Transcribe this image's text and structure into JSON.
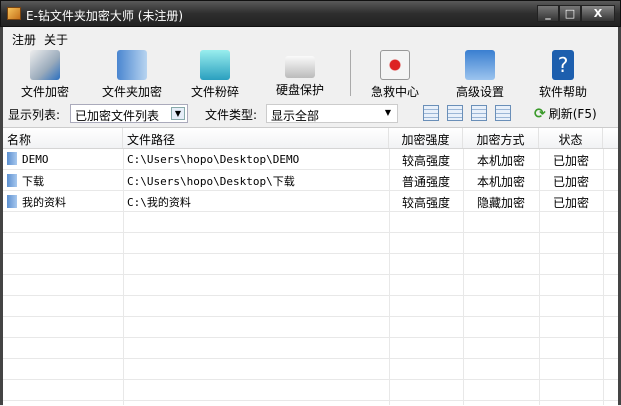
{
  "window": {
    "title": "E-钻文件夹加密大师 (未注册)",
    "minimize": "_",
    "maximize": "□",
    "close": "X"
  },
  "menu": [
    "注册",
    "关于"
  ],
  "toolbar": [
    "文件加密",
    "文件夹加密",
    "文件粉碎",
    "硬盘保护",
    "急救中心",
    "高级设置",
    "软件帮助"
  ],
  "filter": {
    "list_label": "显示列表:",
    "list_value": "已加密文件列表",
    "type_label": "文件类型:",
    "type_value": "显示全部",
    "refresh": "刷新(F5)"
  },
  "table": {
    "headers": [
      "名称",
      "文件路径",
      "加密强度",
      "加密方式",
      "状态"
    ],
    "rows": [
      [
        "DEMO",
        "C:\\Users\\hopo\\Desktop\\DEMO",
        "较高强度",
        "本机加密",
        "已加密"
      ],
      [
        "下载",
        "C:\\Users\\hopo\\Desktop\\下载",
        "普通强度",
        "本机加密",
        "已加密"
      ],
      [
        "我的资料",
        "C:\\我的资料",
        "较高强度",
        "隐藏加密",
        "已加密"
      ]
    ]
  }
}
